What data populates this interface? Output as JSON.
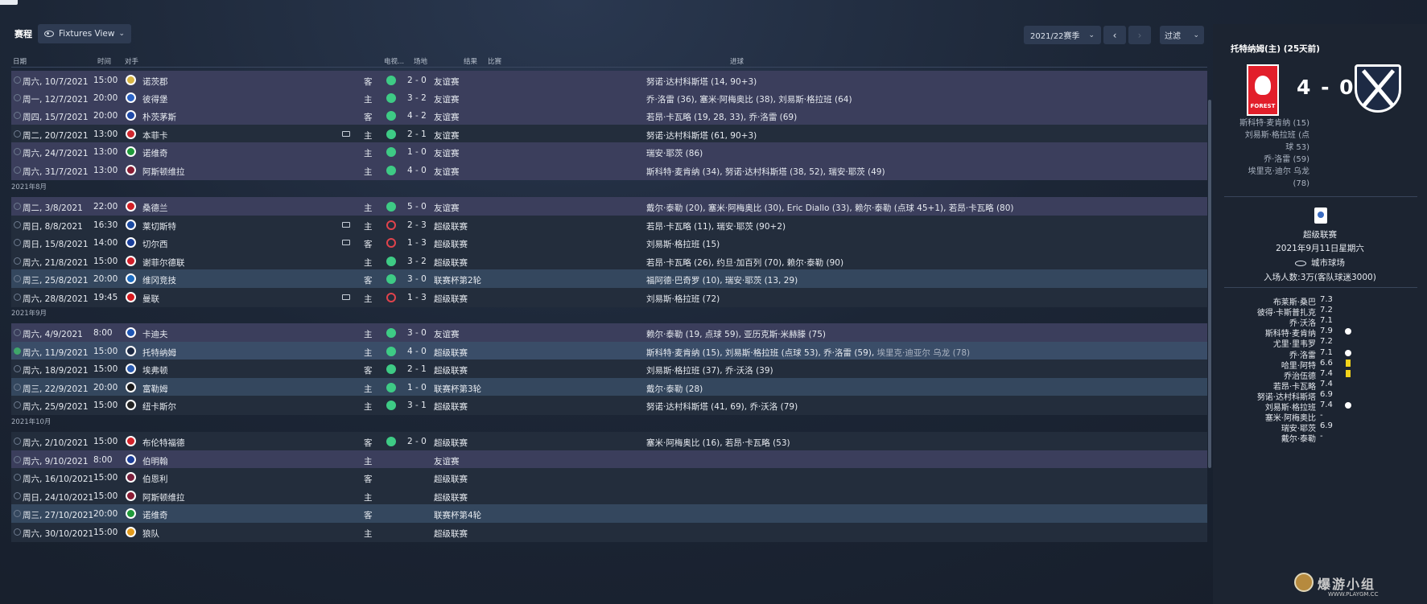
{
  "header": {
    "title": "赛程",
    "view_label": "Fixtures View",
    "season_label": "2021/22赛季",
    "prev": "‹",
    "next": "›",
    "filter_label": "过滤"
  },
  "columns": {
    "date": "日期",
    "time": "时间",
    "opponent": "对手",
    "tv": "电视...",
    "venue": "场地",
    "result": "结果",
    "competition": "比赛",
    "scorers": "进球"
  },
  "months": [
    "2021年8月",
    "2021年9月",
    "2021年10月"
  ],
  "fixtures": [
    {
      "date": "周六, 10/7/2021",
      "time": "15:00",
      "opponent": "诺茨郡",
      "venue": "客",
      "outcome": "win",
      "score": "2 - 0",
      "comp": "友谊赛",
      "scorers": "努诺·达村科斯塔 (14, 90+3)",
      "crest": "#d8b545"
    },
    {
      "date": "周一, 12/7/2021",
      "time": "20:00",
      "opponent": "彼得堡",
      "venue": "主",
      "outcome": "win",
      "score": "3 - 2",
      "comp": "友谊赛",
      "scorers": "乔·洛雷 (36), 塞米·阿梅奥比 (38), 刘易斯·格拉班 (64)",
      "crest": "#2a62c5"
    },
    {
      "date": "周四, 15/7/2021",
      "time": "20:00",
      "opponent": "朴茨茅斯",
      "venue": "客",
      "outcome": "win",
      "score": "4 - 2",
      "comp": "友谊赛",
      "scorers": "若昂·卡瓦略 (19, 28, 33), 乔·洛雷 (69)",
      "crest": "#1f4aa8"
    },
    {
      "date": "周二, 20/7/2021",
      "time": "13:00",
      "opponent": "本菲卡",
      "venue": "主",
      "outcome": "win",
      "score": "2 - 1",
      "comp": "友谊赛",
      "scorers": "努诺·达村科斯塔 (61, 90+3)",
      "crest": "#d0282e",
      "tv": true
    },
    {
      "date": "周六, 24/7/2021",
      "time": "13:00",
      "opponent": "诺维奇",
      "venue": "主",
      "outcome": "win",
      "score": "1 - 0",
      "comp": "友谊赛",
      "scorers": "瑞安·耶茨 (86)",
      "crest": "#1f9a3a"
    },
    {
      "date": "周六, 31/7/2021",
      "time": "13:00",
      "opponent": "阿斯顿维拉",
      "venue": "主",
      "outcome": "win",
      "score": "4 - 0",
      "comp": "友谊赛",
      "scorers": "斯科特·麦肯纳 (34), 努诺·达村科斯塔 (38, 52), 瑞安·耶茨 (49)",
      "crest": "#8a1c34"
    },
    {
      "date": "周二, 3/8/2021",
      "time": "22:00",
      "opponent": "桑德兰",
      "venue": "主",
      "outcome": "win",
      "score": "5 - 0",
      "comp": "友谊赛",
      "scorers": "戴尔·泰勒 (20), 塞米·阿梅奥比 (30), Eric Diallo (33), 赖尔·泰勒 (点球 45+1), 若昂·卡瓦略 (80)",
      "crest": "#d21f26"
    },
    {
      "date": "周日, 8/8/2021",
      "time": "16:30",
      "opponent": "莱切斯特",
      "venue": "主",
      "outcome": "loss",
      "score": "2 - 3",
      "comp": "超级联赛",
      "scorers": "若昂·卡瓦略 (11), 瑞安·耶茨 (90+2)",
      "crest": "#1b4aa0",
      "tv": true
    },
    {
      "date": "周日, 15/8/2021",
      "time": "14:00",
      "opponent": "切尔西",
      "venue": "客",
      "outcome": "loss",
      "score": "1 - 3",
      "comp": "超级联赛",
      "scorers": "刘易斯·格拉班 (15)",
      "crest": "#1a3f9c",
      "tv": true
    },
    {
      "date": "周六, 21/8/2021",
      "time": "15:00",
      "opponent": "谢菲尔德联",
      "venue": "主",
      "outcome": "win",
      "score": "3 - 2",
      "comp": "超级联赛",
      "scorers": "若昂·卡瓦略 (26), 约旦·加百列 (70), 赖尔·泰勒 (90)",
      "crest": "#d01f2a"
    },
    {
      "date": "周三, 25/8/2021",
      "time": "20:00",
      "opponent": "维冈竞技",
      "venue": "客",
      "outcome": "win",
      "score": "3 - 0",
      "comp": "联赛杯第2轮",
      "scorers": "福阿德·巴奇罗 (10), 瑞安·耶茨 (13, 29)",
      "crest": "#1d6dc2"
    },
    {
      "date": "周六, 28/8/2021",
      "time": "19:45",
      "opponent": "曼联",
      "venue": "主",
      "outcome": "loss",
      "score": "1 - 3",
      "comp": "超级联赛",
      "scorers": "刘易斯·格拉班 (72)",
      "crest": "#d6191f",
      "tv": true
    },
    {
      "date": "周六, 4/9/2021",
      "time": "8:00",
      "opponent": "卡迪夫",
      "venue": "主",
      "outcome": "win",
      "score": "3 - 0",
      "comp": "友谊赛",
      "scorers": "赖尔·泰勒 (19, 点球 59), 亚历克斯·米赫滕 (75)",
      "crest": "#1e56b5"
    },
    {
      "date": "周六, 11/9/2021",
      "time": "15:00",
      "opponent": "托特纳姆",
      "venue": "主",
      "outcome": "win",
      "score": "4 - 0",
      "comp": "超级联赛",
      "scorers": "斯科特·麦肯纳 (15), 刘易斯·格拉班 (点球 53), 乔·洛雷 (59),",
      "scorers_extra": "埃里克·迪亚尔 乌龙 (78)",
      "crest": "#1d2a44",
      "done": true
    },
    {
      "date": "周六, 18/9/2021",
      "time": "15:00",
      "opponent": "埃弗顿",
      "venue": "客",
      "outcome": "win",
      "score": "2 - 1",
      "comp": "超级联赛",
      "scorers": "刘易斯·格拉班 (37), 乔·沃洛 (39)",
      "crest": "#2a5bb0"
    },
    {
      "date": "周三, 22/9/2021",
      "time": "20:00",
      "opponent": "富勒姆",
      "venue": "主",
      "outcome": "win",
      "score": "1 - 0",
      "comp": "联赛杯第3轮",
      "scorers": "戴尔·泰勒 (28)",
      "crest": "#1b1b1b"
    },
    {
      "date": "周六, 25/9/2021",
      "time": "15:00",
      "opponent": "纽卡斯尔",
      "venue": "主",
      "outcome": "win",
      "score": "3 - 1",
      "comp": "超级联赛",
      "scorers": "努诺·达村科斯塔 (41, 69), 乔·沃洛 (79)",
      "crest": "#222222"
    },
    {
      "date": "周六, 2/10/2021",
      "time": "15:00",
      "opponent": "布伦特福德",
      "venue": "客",
      "outcome": "win",
      "score": "2 - 0",
      "comp": "超级联赛",
      "scorers": "塞米·阿梅奥比 (16), 若昂·卡瓦略 (53)",
      "crest": "#d2232a"
    },
    {
      "date": "周六, 9/10/2021",
      "time": "8:00",
      "opponent": "伯明翰",
      "venue": "主",
      "outcome": "",
      "score": "",
      "comp": "友谊赛",
      "scorers": "",
      "crest": "#1d3f9a"
    },
    {
      "date": "周六, 16/10/2021",
      "time": "15:00",
      "opponent": "伯恩利",
      "venue": "客",
      "outcome": "",
      "score": "",
      "comp": "超级联赛",
      "scorers": "",
      "crest": "#7a1f3c"
    },
    {
      "date": "周日, 24/10/2021",
      "time": "15:00",
      "opponent": "阿斯顿维拉",
      "venue": "主",
      "outcome": "",
      "score": "",
      "comp": "超级联赛",
      "scorers": "",
      "crest": "#8a1c34"
    },
    {
      "date": "周三, 27/10/2021",
      "time": "20:00",
      "opponent": "诺维奇",
      "venue": "客",
      "outcome": "",
      "score": "",
      "comp": "联赛杯第4轮",
      "scorers": "",
      "crest": "#1f9a3a"
    },
    {
      "date": "周六, 30/10/2021",
      "time": "15:00",
      "opponent": "狼队",
      "venue": "主",
      "outcome": "",
      "score": "",
      "comp": "超级联赛",
      "scorers": "",
      "crest": "#e19a1c"
    }
  ],
  "match_panel": {
    "title": "托特纳姆(主) (25天前)",
    "score": "4 - 0",
    "home_crest_text": "FOREST",
    "scorers": [
      "斯科特·麦肯纳 (15)",
      "刘易斯·格拉班 (点",
      "球 53)",
      "乔·洛雷 (59)",
      "埃里克·迪尔 乌龙",
      "(78)"
    ],
    "competition": "超级联赛",
    "date": "2021年9月11日星期六",
    "stadium": "城市球场",
    "attendance": "入场人数:3万(客队球迷3000)",
    "ratings": [
      {
        "name": "布莱斯·桑巴",
        "value": "7.3"
      },
      {
        "name": "彼得·卡斯普扎克",
        "value": "7.2"
      },
      {
        "name": "乔·沃洛",
        "value": "7.1"
      },
      {
        "name": "斯科特·麦肯纳",
        "value": "7.9",
        "icon": "ball"
      },
      {
        "name": "尤里·里韦罗",
        "value": "7.2"
      },
      {
        "name": "乔·洛雷",
        "value": "7.1",
        "icon": "ball"
      },
      {
        "name": "哈里·阿特",
        "value": "6.6",
        "icon": "card"
      },
      {
        "name": "乔治伍德",
        "value": "7.4",
        "icon": "card"
      },
      {
        "name": "若昂·卡瓦略",
        "value": "7.4"
      },
      {
        "name": "努诺·达村科斯塔",
        "value": "6.9"
      },
      {
        "name": "刘易斯·格拉班",
        "value": "7.4",
        "icon": "ball"
      },
      {
        "name": "塞米·阿梅奥比",
        "value": "-"
      },
      {
        "name": "瑞安·耶茨",
        "value": "6.9"
      },
      {
        "name": "戴尔·泰勒",
        "value": "-"
      }
    ]
  },
  "watermark": {
    "text": "爆游小组",
    "url": "WWW.PLAYGM.CC"
  }
}
